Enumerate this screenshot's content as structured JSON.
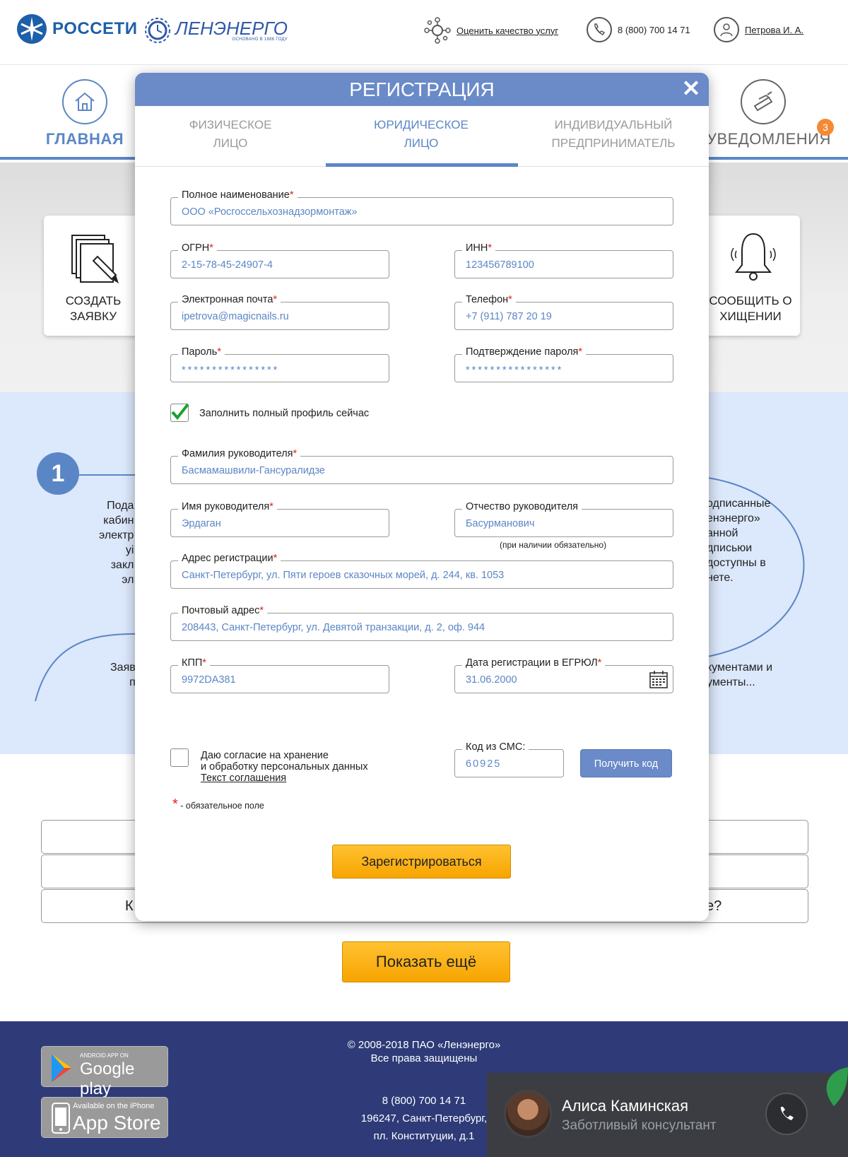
{
  "header": {
    "rosseti": "РОССЕТИ",
    "lenenergo": "ЛЕНЭНЕРГО",
    "lenenergo_sub": "ОСНОВАНО В 1886 ГОДУ",
    "rate_link": "Оценить качество услуг",
    "phone": "8 (800) 700 14 71",
    "user": "Петрова И. А."
  },
  "nav": {
    "home": "ГЛАВНАЯ",
    "notifications": "УВЕДОМЛЕНИЯ",
    "notifications_count": "3"
  },
  "actions": {
    "create": "СОЗДАТЬ ЗАЯВКУ",
    "report": "СООБЩИТЬ О ХИЩЕНИИ"
  },
  "steps": {
    "number": "1",
    "left_text": "Пода\nкабин\nэлектр\nуі\nзакл\nэл",
    "right_text": "одписанные\nенэнерго»\nанной\nдписьюи\nдоступны в\nнете.",
    "left_bottom": "Заяв\nп",
    "right_bottom": "кументами и\nументы..."
  },
  "faq": {
    "row3_left": "К",
    "row3_right": "е?"
  },
  "show_more": "Показать ещё",
  "footer": {
    "google_small": "ANDROID APP ON",
    "google_big": "Google play",
    "apple_small": "Available on the iPhone",
    "apple_big": "App Store",
    "copyright": "© 2008-2018 ПАО «Ленэнерго»\nВсе права защищены",
    "contacts": "8 (800) 700 14 71\n196247, Санкт-Петербург,\nпл. Конституции, д.1"
  },
  "consultant": {
    "name": "Алиса Каминская",
    "role": "Заботливый консультант"
  },
  "modal": {
    "title": "РЕГИСТРАЦИЯ",
    "tabs": [
      "ФИЗИЧЕСКОЕ\nЛИЦО",
      "ЮРИДИЧЕСКОЕ\nЛИЦО",
      "ИНДИВИДУАЛЬНЫЙ\nПРЕДПРИНИМАТЕЛЬ"
    ],
    "fields": {
      "full_name": {
        "label": "Полное наименование",
        "value": "ООО «Росгоссельхознадзормонтаж»"
      },
      "ogrn": {
        "label": "ОГРН",
        "value": "2-15-78-45-24907-4"
      },
      "inn": {
        "label": "ИНН",
        "value": "123456789100"
      },
      "email": {
        "label": "Электронная почта",
        "value": "ipetrova@magicnails.ru"
      },
      "phone": {
        "label": "Телефон",
        "value": "+7 (911) 787 20 19"
      },
      "password": {
        "label": "Пароль",
        "value": "****************"
      },
      "password_confirm": {
        "label": "Подтверждение пароля",
        "value": "****************"
      },
      "director_surname": {
        "label": "Фамилия руководителя",
        "value": "Басмамашвили-Гансуралидзе"
      },
      "director_name": {
        "label": "Имя руководителя",
        "value": "Эрдаган"
      },
      "director_patronymic": {
        "label": "Отчество руководителя",
        "value": "Басурманович"
      },
      "address_reg": {
        "label": "Адрес регистрации",
        "value": "Санкт-Петербург, ул. Пяти героев сказочных морей, д. 244, кв. 1053"
      },
      "address_post": {
        "label": "Почтовый адрес",
        "value": "208443, Санкт-Петербург, ул. Девятой транзакции, д. 2, оф. 944"
      },
      "kpp": {
        "label": "КПП",
        "value": "9972DA381"
      },
      "egrul_date": {
        "label": "Дата регистрации в ЕГРЮЛ",
        "value": "31.06.2000"
      },
      "sms_code": {
        "label": "Код из СМС:",
        "value": "60925"
      }
    },
    "patronymic_hint": "(при наличии обязательно)",
    "fill_profile": "Заполнить полный профиль сейчас",
    "fill_profile_checked": true,
    "consent_line1": "Даю согласие на хранение",
    "consent_line2": "и обработку персональных данных",
    "consent_link": "Текст соглашения",
    "consent_checked": false,
    "get_code": "Получить код",
    "required_star": "*",
    "required_note": "- обязательное поле",
    "register": "Зарегистрироваться"
  },
  "colors": {
    "accent": "#5b86c6",
    "modal_header": "#6a8ac8",
    "button_orange": "#f7a400",
    "footer": "#2e3b78",
    "badge": "#f58a34",
    "required": "#dd2222"
  }
}
